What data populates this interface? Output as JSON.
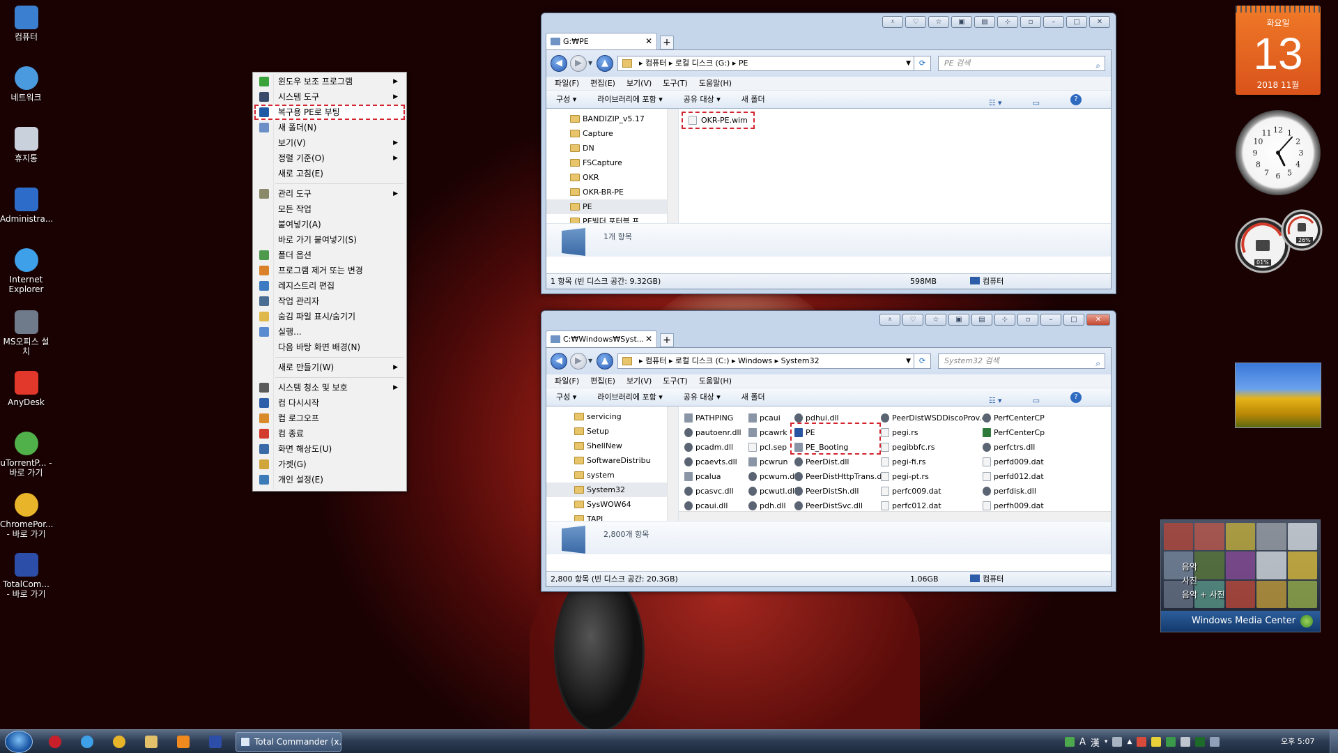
{
  "desktop": {
    "icons": [
      {
        "label": "컴퓨터",
        "icon": "computer-icon",
        "color": "#3b7fd0"
      },
      {
        "label": "네트워크",
        "icon": "network-icon",
        "color": "#4a9ae0"
      },
      {
        "label": "휴지통",
        "icon": "recycle-bin-icon",
        "color": "#c9d1dc"
      },
      {
        "label": "Administra...",
        "icon": "user-icon",
        "color": "#2d6cc8"
      },
      {
        "label": "Internet Explorer",
        "icon": "internet-explorer-icon",
        "color": "#3ea0e8"
      },
      {
        "label": "MS오피스 설치",
        "icon": "installer-icon",
        "color": "#6f7b8a"
      },
      {
        "label": "AnyDesk",
        "icon": "anydesk-icon",
        "color": "#e2382b"
      },
      {
        "label": "uTorrentP... - 바로 가기",
        "icon": "utorrent-icon",
        "color": "#50b04a"
      },
      {
        "label": "ChromePor... - 바로 가기",
        "icon": "chrome-icon",
        "color": "#e8b52a"
      },
      {
        "label": "TotalCom... - 바로 가기",
        "icon": "floppy-disk-icon",
        "color": "#2c4ea8"
      }
    ]
  },
  "context_menu": {
    "items": [
      {
        "type": "item",
        "label": "윈도우 보조 프로그램",
        "icon": "check-icon",
        "color": "#3aa33a",
        "submenu": true
      },
      {
        "type": "item",
        "label": "시스템 도구",
        "icon": "system-tools-icon",
        "color": "#3a4a6a",
        "submenu": true
      },
      {
        "type": "item",
        "label": "복구용 PE로 부팅",
        "icon": "pe-icon",
        "color": "#1f5aa6",
        "submenu": false,
        "highlighted": true
      },
      {
        "type": "item",
        "label": "새 폴더(N)",
        "icon": "new-folder-icon",
        "color": "#6b8fc7",
        "submenu": false
      },
      {
        "type": "item",
        "label": "보기(V)",
        "icon": "",
        "color": "",
        "submenu": true
      },
      {
        "type": "item",
        "label": "정렬 기준(O)",
        "icon": "",
        "color": "",
        "submenu": true
      },
      {
        "type": "item",
        "label": "새로 고침(E)",
        "icon": "",
        "color": "",
        "submenu": false
      },
      {
        "type": "sep"
      },
      {
        "type": "item",
        "label": "관리 도구",
        "icon": "admin-tools-icon",
        "color": "#8a8a6a",
        "submenu": true
      },
      {
        "type": "item",
        "label": "모든 작업",
        "icon": "",
        "color": "",
        "submenu": false
      },
      {
        "type": "item",
        "label": "붙여넣기(A)",
        "icon": "",
        "color": "",
        "submenu": false
      },
      {
        "type": "item",
        "label": "바로 가기 붙여넣기(S)",
        "icon": "",
        "color": "",
        "submenu": false
      },
      {
        "type": "item",
        "label": "폴더 옵션",
        "icon": "folder-options-icon",
        "color": "#4d9a4d",
        "submenu": false
      },
      {
        "type": "item",
        "label": "프로그램 제거 또는 변경",
        "icon": "programs-icon",
        "color": "#d9822b",
        "submenu": false
      },
      {
        "type": "item",
        "label": "레지스트리 편집",
        "icon": "registry-icon",
        "color": "#3c7bc2",
        "submenu": false
      },
      {
        "type": "item",
        "label": "작업 관리자",
        "icon": "task-manager-icon",
        "color": "#4a6d94",
        "submenu": false
      },
      {
        "type": "item",
        "label": "숨김 파일 표시/숨기기",
        "icon": "hidden-files-icon",
        "color": "#e0b84a",
        "submenu": false
      },
      {
        "type": "item",
        "label": "실행...",
        "icon": "run-icon",
        "color": "#5a8ad0",
        "submenu": false
      },
      {
        "type": "item",
        "label": "다음 바탕 화면 배경(N)",
        "icon": "",
        "color": "",
        "submenu": false
      },
      {
        "type": "sep"
      },
      {
        "type": "item",
        "label": "새로 만들기(W)",
        "icon": "",
        "color": "",
        "submenu": true
      },
      {
        "type": "sep"
      },
      {
        "type": "item",
        "label": "시스템 청소 및 보호",
        "icon": "cleanup-icon",
        "color": "#5a5a5a",
        "submenu": true
      },
      {
        "type": "item",
        "label": "컴 다시시작",
        "icon": "restart-icon",
        "color": "#2f5fa8",
        "submenu": false
      },
      {
        "type": "item",
        "label": "컴 로그오프",
        "icon": "logoff-icon",
        "color": "#d98a2b",
        "submenu": false
      },
      {
        "type": "item",
        "label": "컴 종료",
        "icon": "shutdown-icon",
        "color": "#d23b2b",
        "submenu": false
      },
      {
        "type": "item",
        "label": "화면 해상도(U)",
        "icon": "display-icon",
        "color": "#3a6aa8",
        "submenu": false
      },
      {
        "type": "item",
        "label": "가젯(G)",
        "icon": "gadget-icon",
        "color": "#d0a63a",
        "submenu": false
      },
      {
        "type": "item",
        "label": "개인 설정(E)",
        "icon": "personalize-icon",
        "color": "#3d7ab8",
        "submenu": false
      }
    ]
  },
  "window1": {
    "title_buttons": [
      "⩡",
      "♡",
      "☆",
      "▣",
      "▤",
      "⊹",
      "▫",
      "–",
      "□",
      "✕"
    ],
    "tab_label": "G:₩PE",
    "address": [
      "컴퓨터",
      "로컬 디스크 (G:)",
      "PE"
    ],
    "search_placeholder": "PE 검색",
    "menu": [
      "파일(F)",
      "편집(E)",
      "보기(V)",
      "도구(T)",
      "도움말(H)"
    ],
    "commands": [
      "구성 ▾",
      "라이브러리에 포함 ▾",
      "공유 대상 ▾",
      "새 폴더"
    ],
    "tree": [
      {
        "label": "BANDIZIP_v5.17",
        "selected": false
      },
      {
        "label": "Capture",
        "selected": false
      },
      {
        "label": "DN",
        "selected": false
      },
      {
        "label": "FSCapture",
        "selected": false
      },
      {
        "label": "OKR",
        "selected": false
      },
      {
        "label": "OKR-BR-PE",
        "selected": false
      },
      {
        "label": "PE",
        "selected": true
      },
      {
        "label": "PE빌더 포터블 프",
        "selected": false
      }
    ],
    "files": [
      {
        "name": "OKR-PE.wim",
        "icon": "file-icon",
        "highlighted": true
      }
    ],
    "details_text": "1개 항목",
    "status": {
      "left": "1 항목 (빈 디스크 공간: 9.32GB)",
      "size": "598MB",
      "location": "컴퓨터"
    }
  },
  "window2": {
    "title_buttons": [
      "⩡",
      "♡",
      "☆",
      "▣",
      "▤",
      "⊹",
      "▫",
      "–",
      "□",
      "✕"
    ],
    "tab_label": "C:₩Windows₩Syst...",
    "address": [
      "컴퓨터",
      "로컬 디스크 (C:)",
      "Windows",
      "System32"
    ],
    "search_placeholder": "System32 검색",
    "menu": [
      "파일(F)",
      "편집(E)",
      "보기(V)",
      "도구(T)",
      "도움말(H)"
    ],
    "commands": [
      "구성 ▾",
      "라이브러리에 포함 ▾",
      "공유 대상 ▾",
      "새 폴더"
    ],
    "tree": [
      {
        "label": "servicing",
        "selected": false
      },
      {
        "label": "Setup",
        "selected": false
      },
      {
        "label": "ShellNew",
        "selected": false
      },
      {
        "label": "SoftwareDistribu",
        "selected": false
      },
      {
        "label": "system",
        "selected": false
      },
      {
        "label": "System32",
        "selected": true
      },
      {
        "label": "SysWOW64",
        "selected": false
      },
      {
        "label": "TAPI",
        "selected": false
      }
    ],
    "columns": [
      [
        {
          "name": "PATHPING",
          "k": "exe"
        },
        {
          "name": "pautoenr.dll",
          "k": "dll"
        },
        {
          "name": "pcadm.dll",
          "k": "dll"
        },
        {
          "name": "pcaevts.dll",
          "k": "dll"
        },
        {
          "name": "pcalua",
          "k": "exe"
        },
        {
          "name": "pcasvc.dll",
          "k": "dll"
        },
        {
          "name": "pcaui.dll",
          "k": "dll"
        }
      ],
      [
        {
          "name": "pcaui",
          "k": "exe"
        },
        {
          "name": "pcawrk",
          "k": "exe"
        },
        {
          "name": "pcl.sep",
          "k": "file"
        },
        {
          "name": "pcwrun",
          "k": "exe"
        },
        {
          "name": "pcwum.dll",
          "k": "dll"
        },
        {
          "name": "pcwutl.dll",
          "k": "dll"
        },
        {
          "name": "pdh.dll",
          "k": "dll"
        }
      ],
      [
        {
          "name": "pdhui.dll",
          "k": "dll"
        },
        {
          "name": "PE",
          "k": "pe"
        },
        {
          "name": "PE_Booting",
          "k": "exe"
        },
        {
          "name": "PeerDist.dll",
          "k": "dll"
        },
        {
          "name": "PeerDistHttpTrans.dll",
          "k": "dll"
        },
        {
          "name": "PeerDistSh.dll",
          "k": "dll"
        },
        {
          "name": "PeerDistSvc.dll",
          "k": "dll"
        }
      ],
      [
        {
          "name": "PeerDistWSDDiscoProv.dll",
          "k": "dll"
        },
        {
          "name": "pegi.rs",
          "k": "file"
        },
        {
          "name": "pegibbfc.rs",
          "k": "file"
        },
        {
          "name": "pegi-fi.rs",
          "k": "file"
        },
        {
          "name": "pegi-pt.rs",
          "k": "file"
        },
        {
          "name": "perfc009.dat",
          "k": "file"
        },
        {
          "name": "perfc012.dat",
          "k": "file"
        }
      ],
      [
        {
          "name": "PerfCenterCP",
          "k": "dll"
        },
        {
          "name": "PerfCenterCp",
          "k": "green"
        },
        {
          "name": "perfctrs.dll",
          "k": "dll"
        },
        {
          "name": "perfd009.dat",
          "k": "file"
        },
        {
          "name": "perfd012.dat",
          "k": "file"
        },
        {
          "name": "perfdisk.dll",
          "k": "dll"
        },
        {
          "name": "perfh009.dat",
          "k": "file"
        }
      ]
    ],
    "details_text": "2,800개 항목",
    "status": {
      "left": "2,800 항목 (빈 디스크 공간: 20.3GB)",
      "size": "1.06GB",
      "location": "컴퓨터"
    }
  },
  "gadgets": {
    "calendar": {
      "weekday": "화요일",
      "day": "13",
      "month": "2018 11월"
    },
    "clock": {
      "numbers": [
        "12",
        "1",
        "2",
        "3",
        "4",
        "5",
        "6",
        "7",
        "8",
        "9",
        "10",
        "11"
      ],
      "hour": 5,
      "minute": 7
    },
    "cpu_meter": {
      "cpu": "01%",
      "memory": "26%"
    },
    "media_center": {
      "items": [
        "음악",
        "사진",
        "음악 + 사진"
      ],
      "title": "Windows Media Center"
    }
  },
  "taskbar": {
    "quick_launch": [
      {
        "icon": "opera-icon",
        "color": "#c8202a"
      },
      {
        "icon": "internet-explorer-icon",
        "color": "#3ea0e8"
      },
      {
        "icon": "chrome-icon",
        "color": "#e8b52a"
      },
      {
        "icon": "explorer-folder-icon",
        "color": "#e3c16a"
      },
      {
        "icon": "media-player-icon",
        "color": "#f08a1e"
      },
      {
        "icon": "total-commander-icon",
        "color": "#2c4ea8"
      }
    ],
    "active_item": "Total Commander (x...",
    "tray_text": [
      "A",
      "漢"
    ],
    "clock": "오후 5:07"
  }
}
